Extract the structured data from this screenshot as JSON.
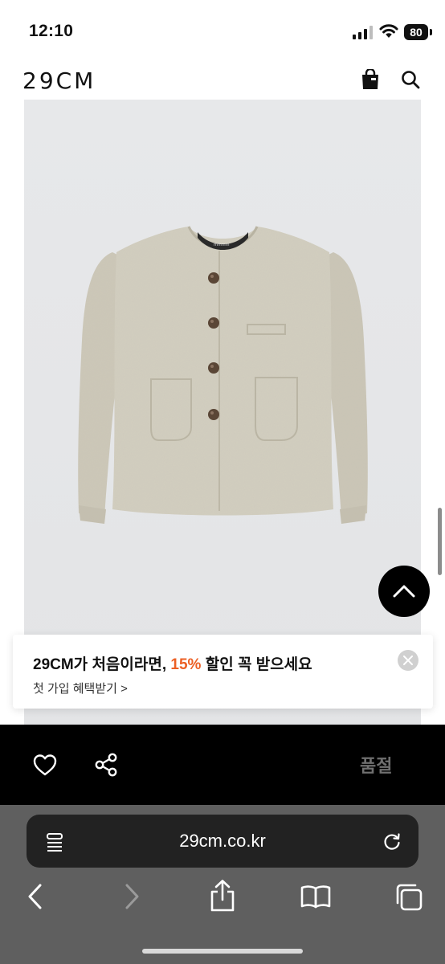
{
  "status_bar": {
    "time": "12:10",
    "battery": "80",
    "icons": [
      "signal-icon",
      "wifi-icon",
      "battery-icon"
    ]
  },
  "header": {
    "brand": "29CM",
    "icons": [
      "shopping-bag-icon",
      "search-icon"
    ]
  },
  "product": {
    "image": "product-image"
  },
  "promo": {
    "title_prefix": "29CM가 처음이라면, ",
    "title_accent": "15%",
    "title_suffix": " 할인 꼭 받으세요",
    "link": "첫 가입 혜택받기 >",
    "accent_color": "#ec5f24"
  },
  "action_bar": {
    "sold_out": "품절",
    "icons": [
      "heart-icon",
      "share-icon"
    ]
  },
  "browser": {
    "url": "29cm.co.kr",
    "icons": [
      "reader-icon",
      "reload-icon",
      "back-icon",
      "forward-icon",
      "share-icon",
      "bookmarks-icon",
      "tabs-icon"
    ]
  }
}
